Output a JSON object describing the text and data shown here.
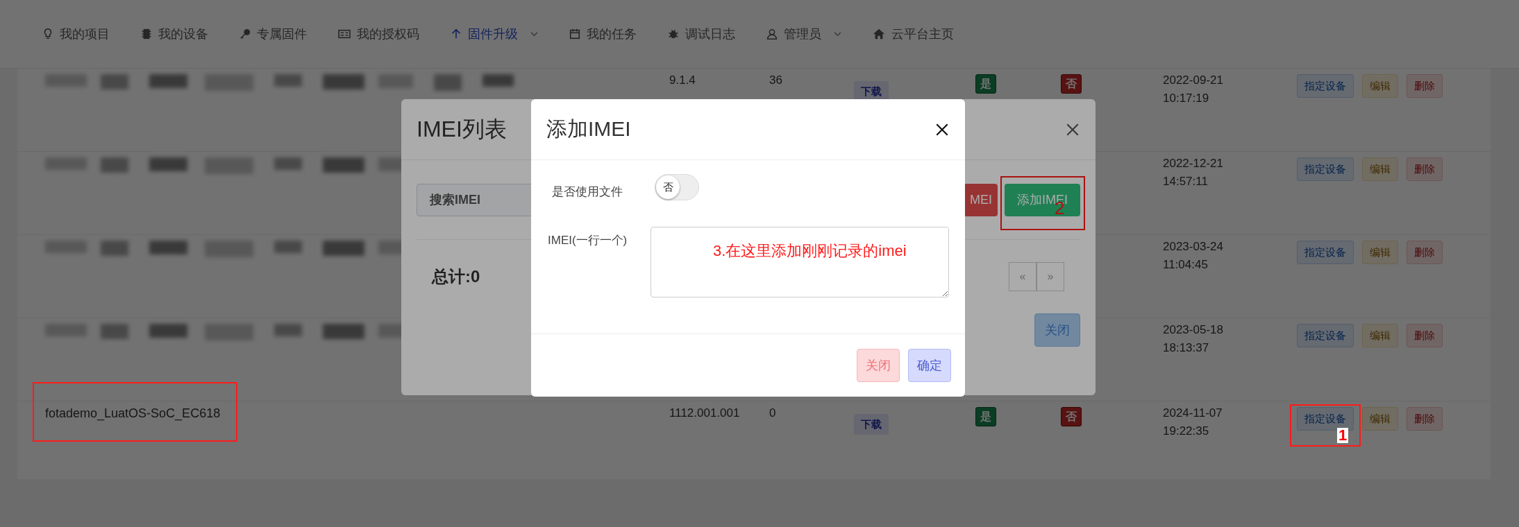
{
  "nav": [
    {
      "label": "我的项目",
      "selected": false,
      "dropdown": false
    },
    {
      "label": "我的设备",
      "selected": false,
      "dropdown": false
    },
    {
      "label": "专属固件",
      "selected": false,
      "dropdown": false
    },
    {
      "label": "我的授权码",
      "selected": false,
      "dropdown": false
    },
    {
      "label": "固件升级",
      "selected": true,
      "dropdown": true
    },
    {
      "label": "我的任务",
      "selected": false,
      "dropdown": false
    },
    {
      "label": "调试日志",
      "selected": false,
      "dropdown": false
    },
    {
      "label": "管理员",
      "selected": false,
      "dropdown": true
    },
    {
      "label": "云平台主页",
      "selected": false,
      "dropdown": false
    }
  ],
  "table": {
    "rows": [
      {
        "name_blurred": true,
        "version": "9.1.4",
        "count": "36",
        "tags": [
          "下载"
        ],
        "yes": "是",
        "no": "否",
        "date": "2022-09-21",
        "time": "10:17:19",
        "actions": [
          {
            "label": "指定设备",
            "kind": "primary"
          },
          {
            "label": "编辑",
            "kind": "warning"
          },
          {
            "label": "删除",
            "kind": "danger"
          }
        ]
      },
      {
        "name_blurred": true,
        "date": "2022-12-21",
        "time": "14:57:11",
        "actions": [
          {
            "label": "指定设备",
            "kind": "primary"
          },
          {
            "label": "编辑",
            "kind": "warning"
          },
          {
            "label": "删除",
            "kind": "danger"
          }
        ]
      },
      {
        "name_blurred": true,
        "date": "2023-03-24",
        "time": "11:04:45",
        "actions": [
          {
            "label": "指定设备",
            "kind": "primary"
          },
          {
            "label": "编辑",
            "kind": "warning"
          },
          {
            "label": "删除",
            "kind": "danger"
          }
        ]
      },
      {
        "name_blurred": true,
        "date": "2023-05-18",
        "time": "18:13:37",
        "actions": [
          {
            "label": "指定设备",
            "kind": "primary"
          },
          {
            "label": "编辑",
            "kind": "warning"
          },
          {
            "label": "删除",
            "kind": "danger"
          }
        ]
      },
      {
        "name": "fotademo_LuatOS-SoC_EC618",
        "name_marked": true,
        "version": "1112.001.001",
        "count": "0",
        "tags": [
          "下载"
        ],
        "yes": "是",
        "no": "否",
        "date": "2024-11-07",
        "time": "19:22:35",
        "actions": [
          {
            "label": "指定设备",
            "kind": "primary",
            "marker": "1"
          },
          {
            "label": "编辑",
            "kind": "warning"
          },
          {
            "label": "删除",
            "kind": "danger"
          }
        ]
      }
    ]
  },
  "imei_list_modal": {
    "title": "IMEI列表",
    "search": {
      "placeholder": "搜索IMEI"
    },
    "buttons": [
      {
        "label": "MEI",
        "kind": "danger"
      },
      {
        "label": "添加IMEI",
        "kind": "success",
        "marker": "2"
      }
    ],
    "total": "总计:0",
    "pager": [
      "«",
      "»"
    ],
    "close_button": "关闭"
  },
  "add_modal": {
    "title": "添加IMEI",
    "use_file": {
      "label": "是否使用文件",
      "toggle": {
        "text": "否",
        "on": false
      }
    },
    "imei": {
      "label": "IMEI(一行一个)",
      "note": "3.在这里添加刚刚记录的imei"
    },
    "buttons": [
      {
        "label": "关闭",
        "kind": "cancel"
      },
      {
        "label": "确定",
        "kind": "confirm"
      }
    ]
  }
}
